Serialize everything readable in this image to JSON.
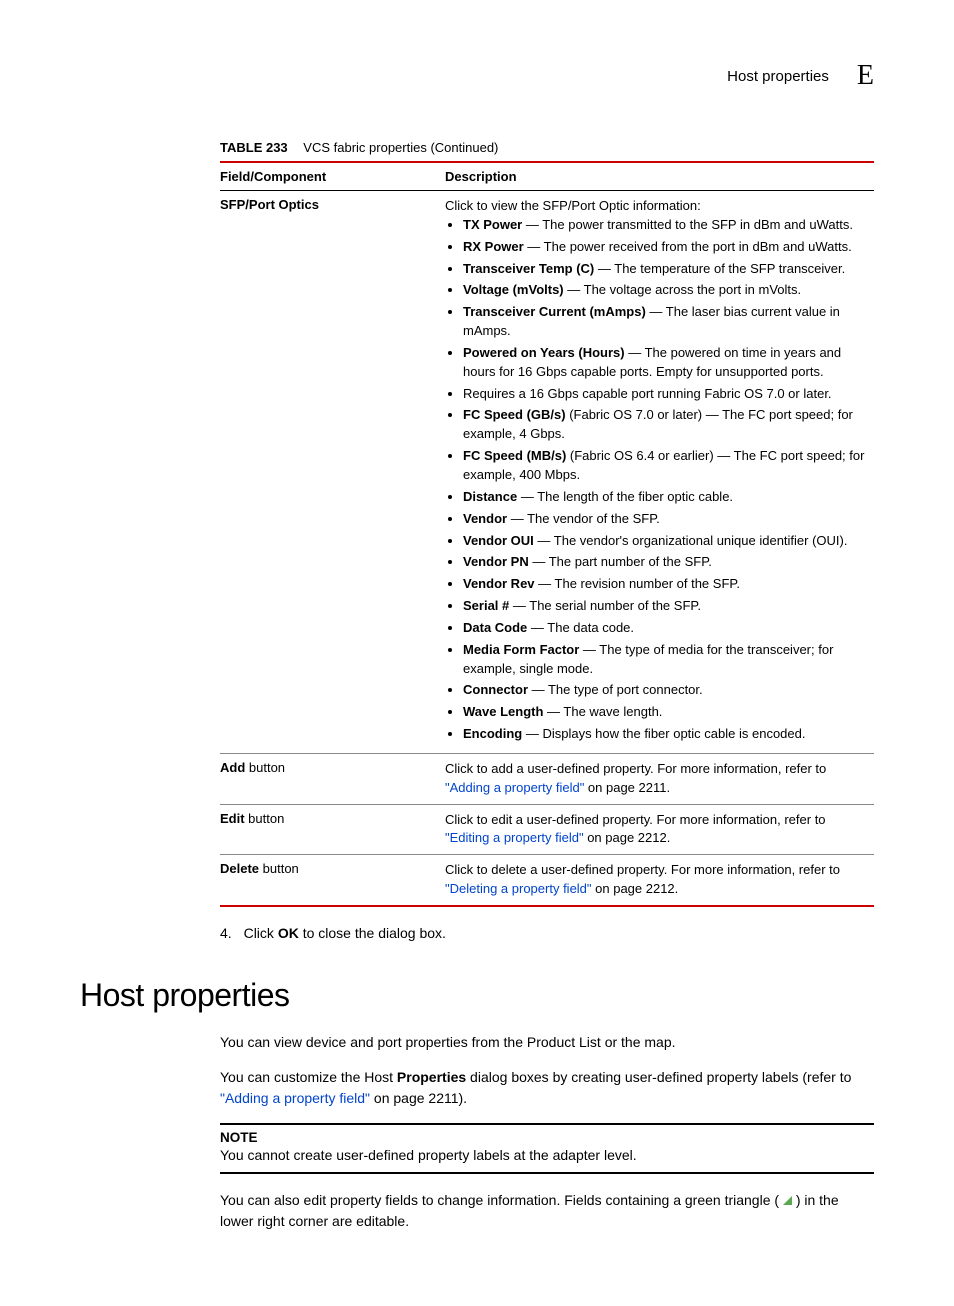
{
  "header": {
    "title": "Host properties",
    "letter": "E"
  },
  "table": {
    "label": "TABLE 233",
    "caption": "VCS fabric properties (Continued)",
    "headers": {
      "field": "Field/Component",
      "desc": "Description"
    },
    "rows": [
      {
        "field": "SFP/Port Optics",
        "intro": "Click to view the SFP/Port Optic information:",
        "bullets": [
          {
            "term": "TX Power",
            "text": " — The power transmitted to the SFP in dBm and uWatts."
          },
          {
            "term": "RX Power",
            "text": " — The power received from the port in dBm and uWatts."
          },
          {
            "term": "Transceiver Temp (C)",
            "text": " — The temperature of the SFP transceiver."
          },
          {
            "term": "Voltage (mVolts)",
            "text": " — The voltage across the port in mVolts."
          },
          {
            "term": "Transceiver Current (mAmps)",
            "text": " — The laser bias current value in mAmps."
          },
          {
            "term": "Powered on Years (Hours)",
            "text": " — The powered on time in years and hours for 16 Gbps capable ports. Empty for unsupported ports."
          },
          {
            "term": "",
            "text": "Requires a 16 Gbps capable port running Fabric OS 7.0 or later."
          },
          {
            "term": "FC Speed (GB/s)",
            "text": " (Fabric OS 7.0 or later) — The FC port speed; for example, 4 Gbps."
          },
          {
            "term": "FC Speed (MB/s)",
            "text": " (Fabric OS 6.4 or earlier) — The FC port speed; for example, 400 Mbps."
          },
          {
            "term": "Distance",
            "text": " — The length of the fiber optic cable."
          },
          {
            "term": "Vendor",
            "text": " — The vendor of the SFP."
          },
          {
            "term": "Vendor OUI",
            "text": " — The vendor's organizational unique identifier (OUI)."
          },
          {
            "term": "Vendor PN",
            "text": " — The part number of the SFP."
          },
          {
            "term": "Vendor Rev",
            "text": " — The revision number of the SFP."
          },
          {
            "term": "Serial #",
            "text": " — The serial number of the SFP."
          },
          {
            "term": "Data Code",
            "text": " — The data code."
          },
          {
            "term": "Media Form Factor",
            "text": " — The type of media for the transceiver; for example, single mode."
          },
          {
            "term": "Connector",
            "text": " — The type of port connector."
          },
          {
            "term": "Wave Length",
            "text": " — The wave length."
          },
          {
            "term": "Encoding",
            "text": " — Displays how the fiber optic cable is encoded."
          }
        ]
      },
      {
        "field_bold": "Add",
        "field_rest": " button",
        "desc_pre": "Click to add a user-defined property. For more information, refer to ",
        "link": "\"Adding a property field\"",
        "desc_post": " on page 2211."
      },
      {
        "field_bold": "Edit",
        "field_rest": " button",
        "desc_pre": "Click to edit a user-defined property. For more information, refer to ",
        "link": "\"Editing a property field\"",
        "desc_post": " on page 2212."
      },
      {
        "field_bold": "Delete",
        "field_rest": " button",
        "desc_pre": "Click to delete a user-defined property. For more information, refer to ",
        "link": "\"Deleting a property field\"",
        "desc_post": " on page 2212."
      }
    ]
  },
  "step": {
    "num": "4.",
    "pre": "Click ",
    "bold": "OK",
    "post": " to close the dialog box."
  },
  "section": {
    "heading": "Host properties",
    "para1": "You can view device and port properties from the Product List or the map.",
    "para2_pre": "You can customize the Host ",
    "para2_bold": "Properties",
    "para2_mid": " dialog boxes by creating user-defined property labels (refer to ",
    "para2_link": "\"Adding a property field\"",
    "para2_post": " on page 2211).",
    "note_label": "NOTE",
    "note_text": "You cannot create user-defined property labels at the adapter level.",
    "para3_pre": "You can also edit property fields to change information. Fields containing a green triangle ( ",
    "para3_post": " ) in the lower right corner are editable."
  }
}
